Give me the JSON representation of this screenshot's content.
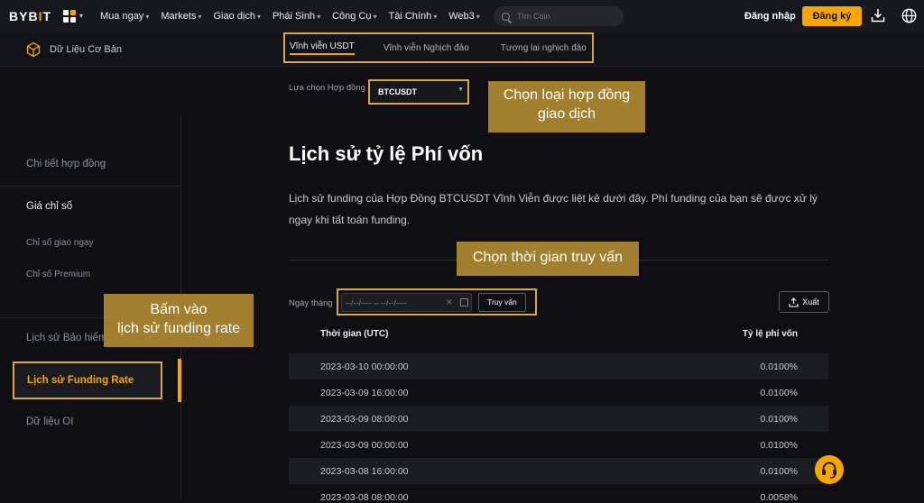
{
  "header": {
    "logo": {
      "prefix": "BYB",
      "accent": "I",
      "suffix": "T"
    },
    "nav": [
      "Mua ngay",
      "Markets",
      "Giao dịch",
      "Phái Sinh",
      "Công Cụ",
      "Tài Chính",
      "Web3"
    ],
    "search_placeholder": "Tìm Coin",
    "login": "Đăng nhập",
    "signup": "Đăng ký"
  },
  "subheader": {
    "label": "Dữ Liệu Cơ Bản",
    "tabs": [
      "Vĩnh viễn USDT",
      "Vĩnh viễn Nghịch đảo",
      "Tương lai nghịch đảo"
    ],
    "active_tab": 0
  },
  "contract": {
    "label": "Lựa chọn Hợp đồng",
    "value": "BTCUSDT"
  },
  "callouts": {
    "contract": [
      "Chọn loại hợp đồng",
      "giao dịch"
    ],
    "time": [
      "Chọn thời gian truy vấn"
    ],
    "sidebar": [
      "Bấm vào",
      "lịch sử funding rate"
    ]
  },
  "sidebar": {
    "items": [
      {
        "label": "Chi tiết hợp đồng"
      },
      {
        "label": "Giá chỉ số"
      },
      {
        "label": "Chỉ số giao ngay"
      },
      {
        "label": "Chỉ số Premium"
      },
      {
        "label": "Lịch sử Bảo hiểm"
      },
      {
        "label": "Lịch sử Funding Rate"
      },
      {
        "label": "Dữ liệu OI"
      }
    ]
  },
  "main": {
    "title": "Lịch sử tỷ lệ Phí vốn",
    "description": "Lịch sử funding của Hợp Đồng BTCUSDT Vĩnh Viễn được liệt kê dưới đây. Phí funding của bạn sẽ được xử lý ngay khi tất toán funding.",
    "date_label": "Ngày tháng",
    "date_placeholder": "--/--/----   – --/--/----",
    "query_button": "Truy vấn",
    "export_button": "Xuất"
  },
  "table": {
    "headers": [
      "Thời gian (UTC)",
      "Tỷ lệ phí vốn"
    ],
    "rows": [
      [
        "2023-03-10 00:00:00",
        "0.0100%"
      ],
      [
        "2023-03-09 16:00:00",
        "0.0100%"
      ],
      [
        "2023-03-09 08:00:00",
        "0.0100%"
      ],
      [
        "2023-03-09 00:00:00",
        "0.0100%"
      ],
      [
        "2023-03-08 16:00:00",
        "0.0100%"
      ],
      [
        "2023-03-08 08:00:00",
        "0.0058%"
      ]
    ]
  },
  "colors": {
    "accent": "#f7a600",
    "callout": "#a27f2f",
    "highlight_border": "#d9a64a"
  }
}
